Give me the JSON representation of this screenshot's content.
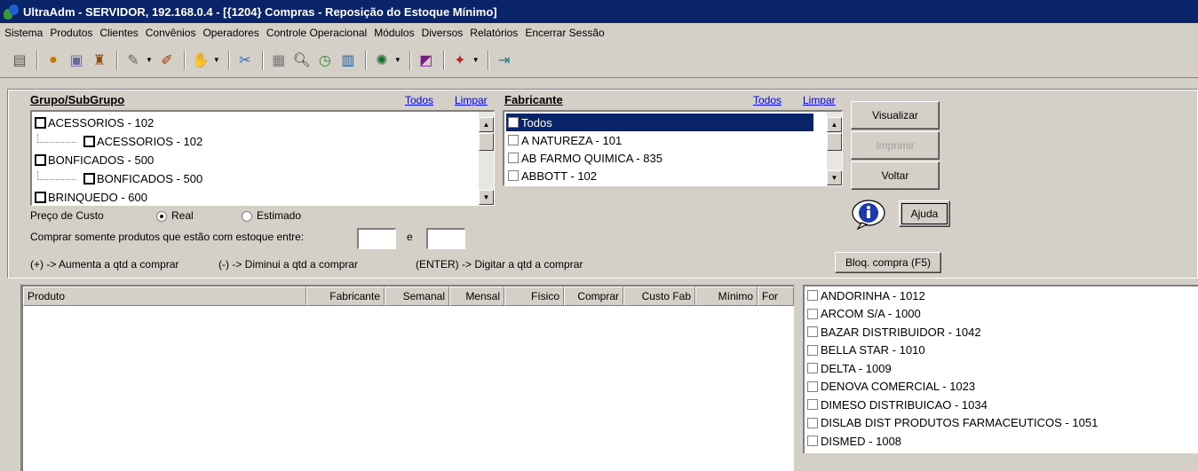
{
  "window": {
    "title": "UltraAdm - SERVIDOR, 192.168.0.4 - [{1204} Compras - Reposição do Estoque Mínimo]"
  },
  "menu": [
    "Sistema",
    "Produtos",
    "Clientes",
    "Convênios",
    "Operadores",
    "Controle Operacional",
    "Módulos",
    "Diversos",
    "Relatórios",
    "Encerrar Sessão"
  ],
  "grupo": {
    "label": "Grupo/SubGrupo",
    "todos": "Todos",
    "limpar": "Limpar",
    "items": [
      {
        "label": "ACESSORIOS - 102",
        "level": 0
      },
      {
        "label": "ACESSORIOS - 102",
        "level": 1
      },
      {
        "label": "BONFICADOS - 500",
        "level": 0
      },
      {
        "label": "BONFICADOS - 500",
        "level": 1
      },
      {
        "label": "BRINQUEDO - 600",
        "level": 0
      }
    ]
  },
  "fabricante": {
    "label": "Fabricante",
    "todos": "Todos",
    "limpar": "Limpar",
    "items": [
      "Todos",
      "A NATUREZA - 101",
      "AB FARMO QUIMICA - 835",
      "ABBOTT - 102"
    ],
    "selected_index": 0
  },
  "buttons": {
    "visualizar": "Visualizar",
    "imprimir": "Imprimir",
    "voltar": "Voltar",
    "ajuda": "Ajuda",
    "bloq": "Bloq. compra (F5)"
  },
  "preco": {
    "label": "Preço de Custo",
    "real": "Real",
    "estimado": "Estimado",
    "selected": "Real"
  },
  "estoque": {
    "label": "Comprar somente produtos que estão com estoque entre:",
    "e": "e",
    "min": "",
    "max": ""
  },
  "hints": {
    "mais": "(+) -> Aumenta a qtd a comprar",
    "menos": "(-) -> Diminui a qtd a comprar",
    "enter": "(ENTER) -> Digitar a qtd a comprar"
  },
  "grid": {
    "columns": [
      "Produto",
      "Fabricante",
      "Semanal",
      "Mensal",
      "Físico",
      "Comprar",
      "Custo Fab",
      "Mínimo",
      "For"
    ]
  },
  "suppliers": [
    "ANDORINHA - 1012",
    "ARCOM S/A - 1000",
    "BAZAR DISTRIBUIDOR - 1042",
    "BELLA STAR - 1010",
    "DELTA - 1009",
    "DENOVA COMERCIAL - 1023",
    "DIMESO DISTRIBUICAO - 1034",
    "DISLAB DIST PRODUTOS FARMACEUTICOS - 1051",
    "DISMED - 1008"
  ]
}
